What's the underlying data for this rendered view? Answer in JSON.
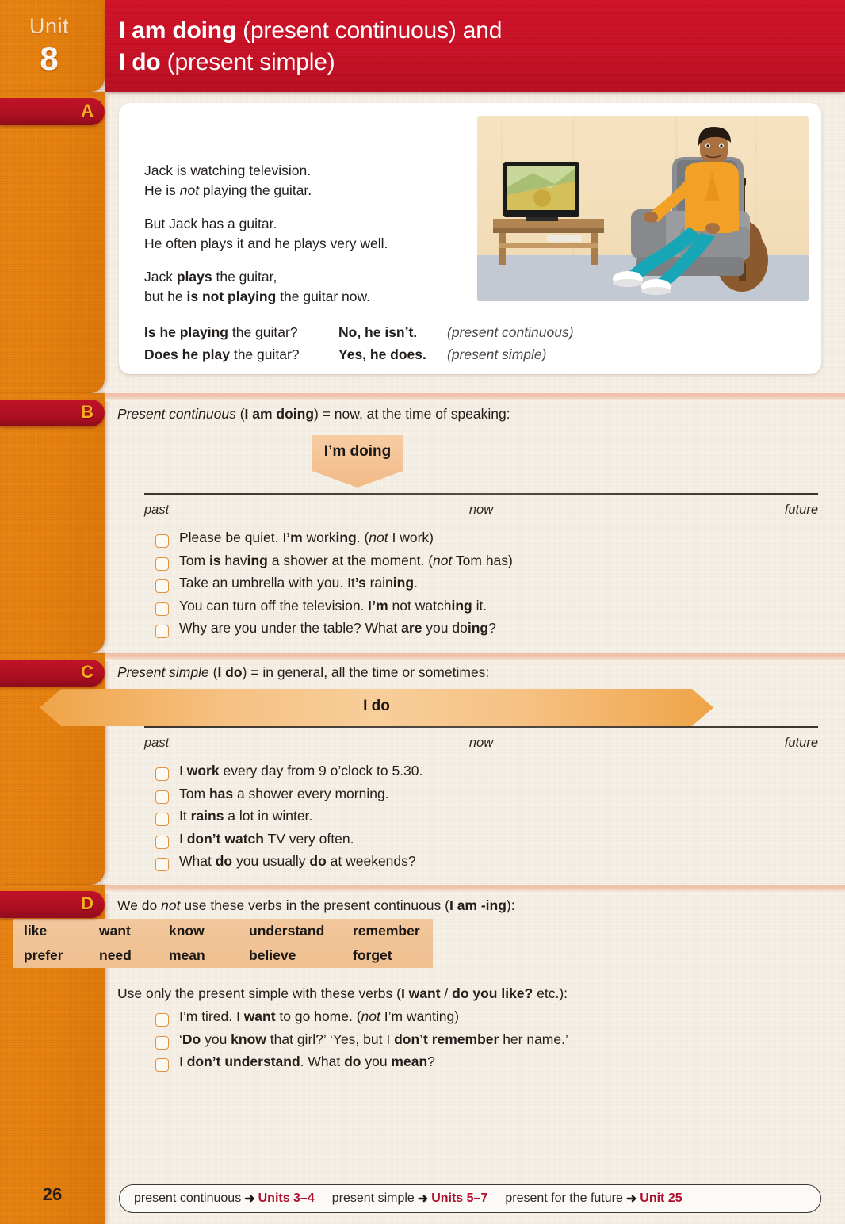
{
  "unit": {
    "word": "Unit",
    "number": "8"
  },
  "title": {
    "line1_bold": "I am doing",
    "line1_rest": " (present continuous) and",
    "line2_bold": "I do",
    "line2_rest": " (present simple)"
  },
  "sections": {
    "a": {
      "letter": "A",
      "paragraph1_line1": "Jack is watching television.",
      "paragraph1_line2_a": "He is ",
      "paragraph1_line2_i": "not",
      "paragraph1_line2_b": " playing the guitar.",
      "paragraph2_line1": "But Jack has a guitar.",
      "paragraph2_line2": "He often plays it and he plays very well.",
      "paragraph3_line1_a": "Jack ",
      "paragraph3_line1_b": "plays",
      "paragraph3_line1_c": " the guitar,",
      "paragraph3_line2_a": "but he ",
      "paragraph3_line2_b": "is not playing",
      "paragraph3_line2_c": " the guitar now.",
      "qa": [
        {
          "q_bold": "Is he playing",
          "q_rest": " the guitar?",
          "a": "No, he isn’t.",
          "label": "(present continuous)"
        },
        {
          "q_bold": "Does he play",
          "q_rest": " the guitar?",
          "a": "Yes, he does.",
          "label": "(present simple)"
        }
      ],
      "illustration_alt": "man-watching-television-with-guitar"
    },
    "b": {
      "letter": "B",
      "lead_italic": "Present continuous",
      "lead_paren_bold": "I am doing",
      "lead_rest": ") = now, at the time of speaking:",
      "marker_label": "I’m doing",
      "timeline": {
        "past": "past",
        "now": "now",
        "future": "future"
      },
      "bullets": [
        {
          "parts": [
            {
              "t": "Please be quiet.  I",
              "s": "n"
            },
            {
              "t": "’m",
              "s": "b"
            },
            {
              "t": " work",
              "s": "n"
            },
            {
              "t": "ing",
              "s": "b"
            },
            {
              "t": ".  (",
              "s": "n"
            },
            {
              "t": "not",
              "s": "i"
            },
            {
              "t": " I work)",
              "s": "n"
            }
          ]
        },
        {
          "parts": [
            {
              "t": "Tom ",
              "s": "n"
            },
            {
              "t": "is",
              "s": "b"
            },
            {
              "t": " hav",
              "s": "n"
            },
            {
              "t": "ing",
              "s": "b"
            },
            {
              "t": " a shower at the moment.   (",
              "s": "n"
            },
            {
              "t": "not",
              "s": "i"
            },
            {
              "t": " Tom has)",
              "s": "n"
            }
          ]
        },
        {
          "parts": [
            {
              "t": "Take an umbrella with you.  It",
              "s": "n"
            },
            {
              "t": "’s",
              "s": "b"
            },
            {
              "t": " rain",
              "s": "n"
            },
            {
              "t": "ing",
              "s": "b"
            },
            {
              "t": ".",
              "s": "n"
            }
          ]
        },
        {
          "parts": [
            {
              "t": "You can turn off the television.  I",
              "s": "n"
            },
            {
              "t": "’m",
              "s": "b"
            },
            {
              "t": " not watch",
              "s": "n"
            },
            {
              "t": "ing",
              "s": "b"
            },
            {
              "t": " it.",
              "s": "n"
            }
          ]
        },
        {
          "parts": [
            {
              "t": "Why are you under the table?  What ",
              "s": "n"
            },
            {
              "t": "are",
              "s": "b"
            },
            {
              "t": " you do",
              "s": "n"
            },
            {
              "t": "ing",
              "s": "b"
            },
            {
              "t": "?",
              "s": "n"
            }
          ]
        }
      ]
    },
    "c": {
      "letter": "C",
      "lead_italic": "Present simple",
      "lead_paren_bold": "I do",
      "lead_rest": ") = in general, all the time or sometimes:",
      "marker_label": "I do",
      "timeline": {
        "past": "past",
        "now": "now",
        "future": "future"
      },
      "bullets": [
        {
          "parts": [
            {
              "t": "I ",
              "s": "n"
            },
            {
              "t": "work",
              "s": "b"
            },
            {
              "t": " every day from 9 o’clock to 5.30.",
              "s": "n"
            }
          ]
        },
        {
          "parts": [
            {
              "t": "Tom ",
              "s": "n"
            },
            {
              "t": "has",
              "s": "b"
            },
            {
              "t": " a shower every morning.",
              "s": "n"
            }
          ]
        },
        {
          "parts": [
            {
              "t": "It ",
              "s": "n"
            },
            {
              "t": "rains",
              "s": "b"
            },
            {
              "t": " a lot in winter.",
              "s": "n"
            }
          ]
        },
        {
          "parts": [
            {
              "t": "I ",
              "s": "n"
            },
            {
              "t": "don’t watch",
              "s": "b"
            },
            {
              "t": " TV very often.",
              "s": "n"
            }
          ]
        },
        {
          "parts": [
            {
              "t": "What ",
              "s": "n"
            },
            {
              "t": "do",
              "s": "b"
            },
            {
              "t": " you usually ",
              "s": "n"
            },
            {
              "t": "do",
              "s": "b"
            },
            {
              "t": " at weekends?",
              "s": "n"
            }
          ]
        }
      ]
    },
    "d": {
      "letter": "D",
      "lead_parts": [
        {
          "t": "We do ",
          "s": "n"
        },
        {
          "t": "not",
          "s": "i"
        },
        {
          "t": " use these verbs in the present continuous (",
          "s": "n"
        },
        {
          "t": "I am -ing",
          "s": "b"
        },
        {
          "t": "):",
          "s": "n"
        }
      ],
      "verb_table": {
        "row1": [
          "like",
          "want",
          "know",
          "understand",
          "remember"
        ],
        "row2": [
          "prefer",
          "need",
          "mean",
          "believe",
          "forget"
        ]
      },
      "lead2_parts": [
        {
          "t": "Use only the present simple with these verbs (",
          "s": "n"
        },
        {
          "t": "I want",
          "s": "b"
        },
        {
          "t": " / ",
          "s": "n"
        },
        {
          "t": "do you like?",
          "s": "b"
        },
        {
          "t": " etc.):",
          "s": "n"
        }
      ],
      "bullets": [
        {
          "parts": [
            {
              "t": "I’m tired.  I ",
              "s": "n"
            },
            {
              "t": "want",
              "s": "b"
            },
            {
              "t": " to go home.   (",
              "s": "n"
            },
            {
              "t": "not",
              "s": "i"
            },
            {
              "t": " I’m wanting)",
              "s": "n"
            }
          ]
        },
        {
          "parts": [
            {
              "t": "‘",
              "s": "n"
            },
            {
              "t": "Do",
              "s": "b"
            },
            {
              "t": " you ",
              "s": "n"
            },
            {
              "t": "know",
              "s": "b"
            },
            {
              "t": " that girl?’     ‘Yes, but I ",
              "s": "n"
            },
            {
              "t": "don’t remember",
              "s": "b"
            },
            {
              "t": " her name.’",
              "s": "n"
            }
          ]
        },
        {
          "parts": [
            {
              "t": "I ",
              "s": "n"
            },
            {
              "t": "don’t understand",
              "s": "b"
            },
            {
              "t": ".  What ",
              "s": "n"
            },
            {
              "t": "do",
              "s": "b"
            },
            {
              "t": " you ",
              "s": "n"
            },
            {
              "t": "mean",
              "s": "b"
            },
            {
              "t": "?",
              "s": "n"
            }
          ]
        }
      ]
    }
  },
  "footer": {
    "page_number": "26",
    "refs": [
      {
        "label": "present continuous",
        "arrow": "➜",
        "target": "Units 3–4"
      },
      {
        "label": "present simple",
        "arrow": "➜",
        "target": "Units 5–7"
      },
      {
        "label": "present for the future",
        "arrow": "➜",
        "target": "Unit 25"
      }
    ]
  },
  "colors": {
    "header_red": "#C50F24",
    "rail_orange": "#E88310",
    "tab_dark_red": "#AE0F22",
    "tab_letter_gold": "#F6B01F",
    "page_bg": "#F6F1E8",
    "marker_peach": "#F4C193",
    "verb_box": "#EFBF90",
    "ref_red": "#B01030"
  }
}
